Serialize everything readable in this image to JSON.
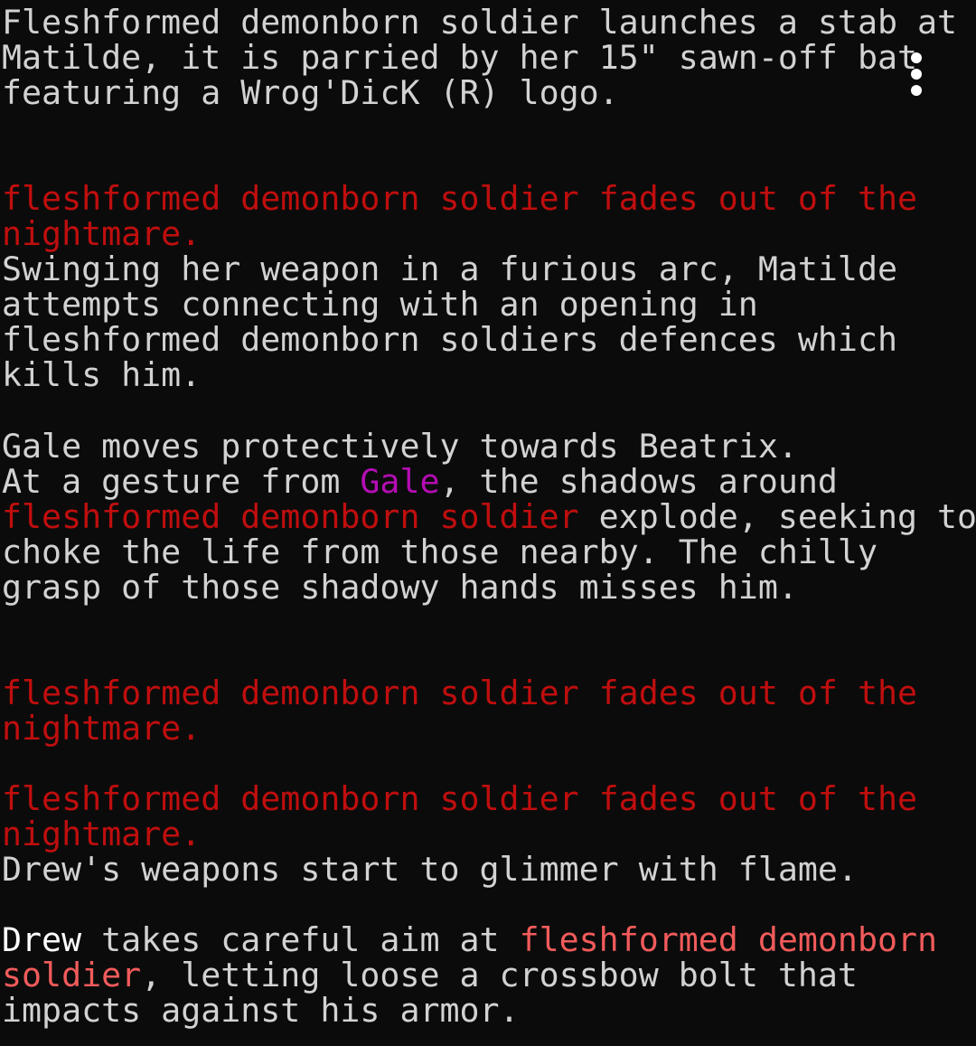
{
  "colors": {
    "background": "#0b0b0b",
    "text": "#d2d2d2",
    "highlight": "#ffffff",
    "enemy": "#c00e0e",
    "target": "#f25b5b",
    "ally": "#b40db4"
  },
  "menu": {
    "icon": "more-vertical-icon"
  },
  "log": [
    [
      {
        "t": "Fleshformed demonborn soldier launches a stab at",
        "c": "gray"
      }
    ],
    [
      {
        "t": "Matilde, it is parried by her 15\" sawn-off bat",
        "c": "gray"
      }
    ],
    [
      {
        "t": "featuring a Wrog'DicK (R) logo.",
        "c": "gray"
      }
    ],
    [],
    [],
    [
      {
        "t": "fleshformed demonborn soldier fades out of the",
        "c": "red"
      }
    ],
    [
      {
        "t": "nightmare.",
        "c": "red"
      }
    ],
    [
      {
        "t": "Swinging her weapon in a furious arc, Matilde",
        "c": "gray"
      }
    ],
    [
      {
        "t": "attempts connecting with an opening in",
        "c": "gray"
      }
    ],
    [
      {
        "t": "fleshformed demonborn soldiers defences which",
        "c": "gray"
      }
    ],
    [
      {
        "t": "kills him.",
        "c": "gray"
      }
    ],
    [],
    [
      {
        "t": "Gale moves protectively towards Beatrix.",
        "c": "gray"
      }
    ],
    [
      {
        "t": "At a gesture from ",
        "c": "gray"
      },
      {
        "t": "Gale",
        "c": "purple"
      },
      {
        "t": ", the shadows around",
        "c": "gray"
      }
    ],
    [
      {
        "t": "fleshformed demonborn soldier",
        "c": "red"
      },
      {
        "t": " explode, seeking to",
        "c": "gray"
      }
    ],
    [
      {
        "t": "choke the life from those nearby. The chilly",
        "c": "gray"
      }
    ],
    [
      {
        "t": "grasp of those shadowy hands misses him.",
        "c": "gray"
      }
    ],
    [],
    [],
    [
      {
        "t": "fleshformed demonborn soldier fades out of the",
        "c": "red"
      }
    ],
    [
      {
        "t": "nightmare.",
        "c": "red"
      }
    ],
    [],
    [
      {
        "t": "fleshformed demonborn soldier fades out of the",
        "c": "red"
      }
    ],
    [
      {
        "t": "nightmare.",
        "c": "red"
      }
    ],
    [
      {
        "t": "Drew's weapons start to glimmer with flame.",
        "c": "gray"
      }
    ],
    [],
    [
      {
        "t": "Drew",
        "c": "white"
      },
      {
        "t": " takes careful aim at ",
        "c": "gray"
      },
      {
        "t": "fleshformed demonborn",
        "c": "lightred"
      }
    ],
    [
      {
        "t": "soldier",
        "c": "lightred"
      },
      {
        "t": ", letting loose a crossbow bolt that",
        "c": "gray"
      }
    ],
    [
      {
        "t": "impacts against his armor.",
        "c": "gray"
      }
    ]
  ]
}
